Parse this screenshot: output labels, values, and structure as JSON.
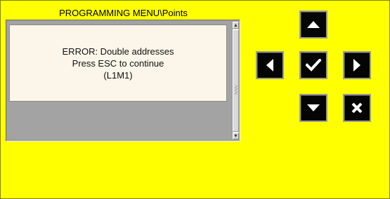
{
  "header": {
    "title": "PROGRAMMING MENU\\Points"
  },
  "message": {
    "line1": "ERROR: Double addresses",
    "line2": "Press ESC to continue",
    "line3": "(L1M1)"
  },
  "scrollbar": {
    "up_glyph": "▲",
    "down_glyph": "▼"
  },
  "navpad": {
    "buttons": [
      "up-arrow-icon",
      "left-arrow-icon",
      "checkmark-icon",
      "right-arrow-icon",
      "down-arrow-icon",
      "x-icon"
    ]
  },
  "colors": {
    "screen_background": "#ffff00",
    "button_background": "#050505",
    "button_glyph": "#ffffff",
    "message_background": "#fbf6e9",
    "list_background": "#a3a3a3"
  }
}
